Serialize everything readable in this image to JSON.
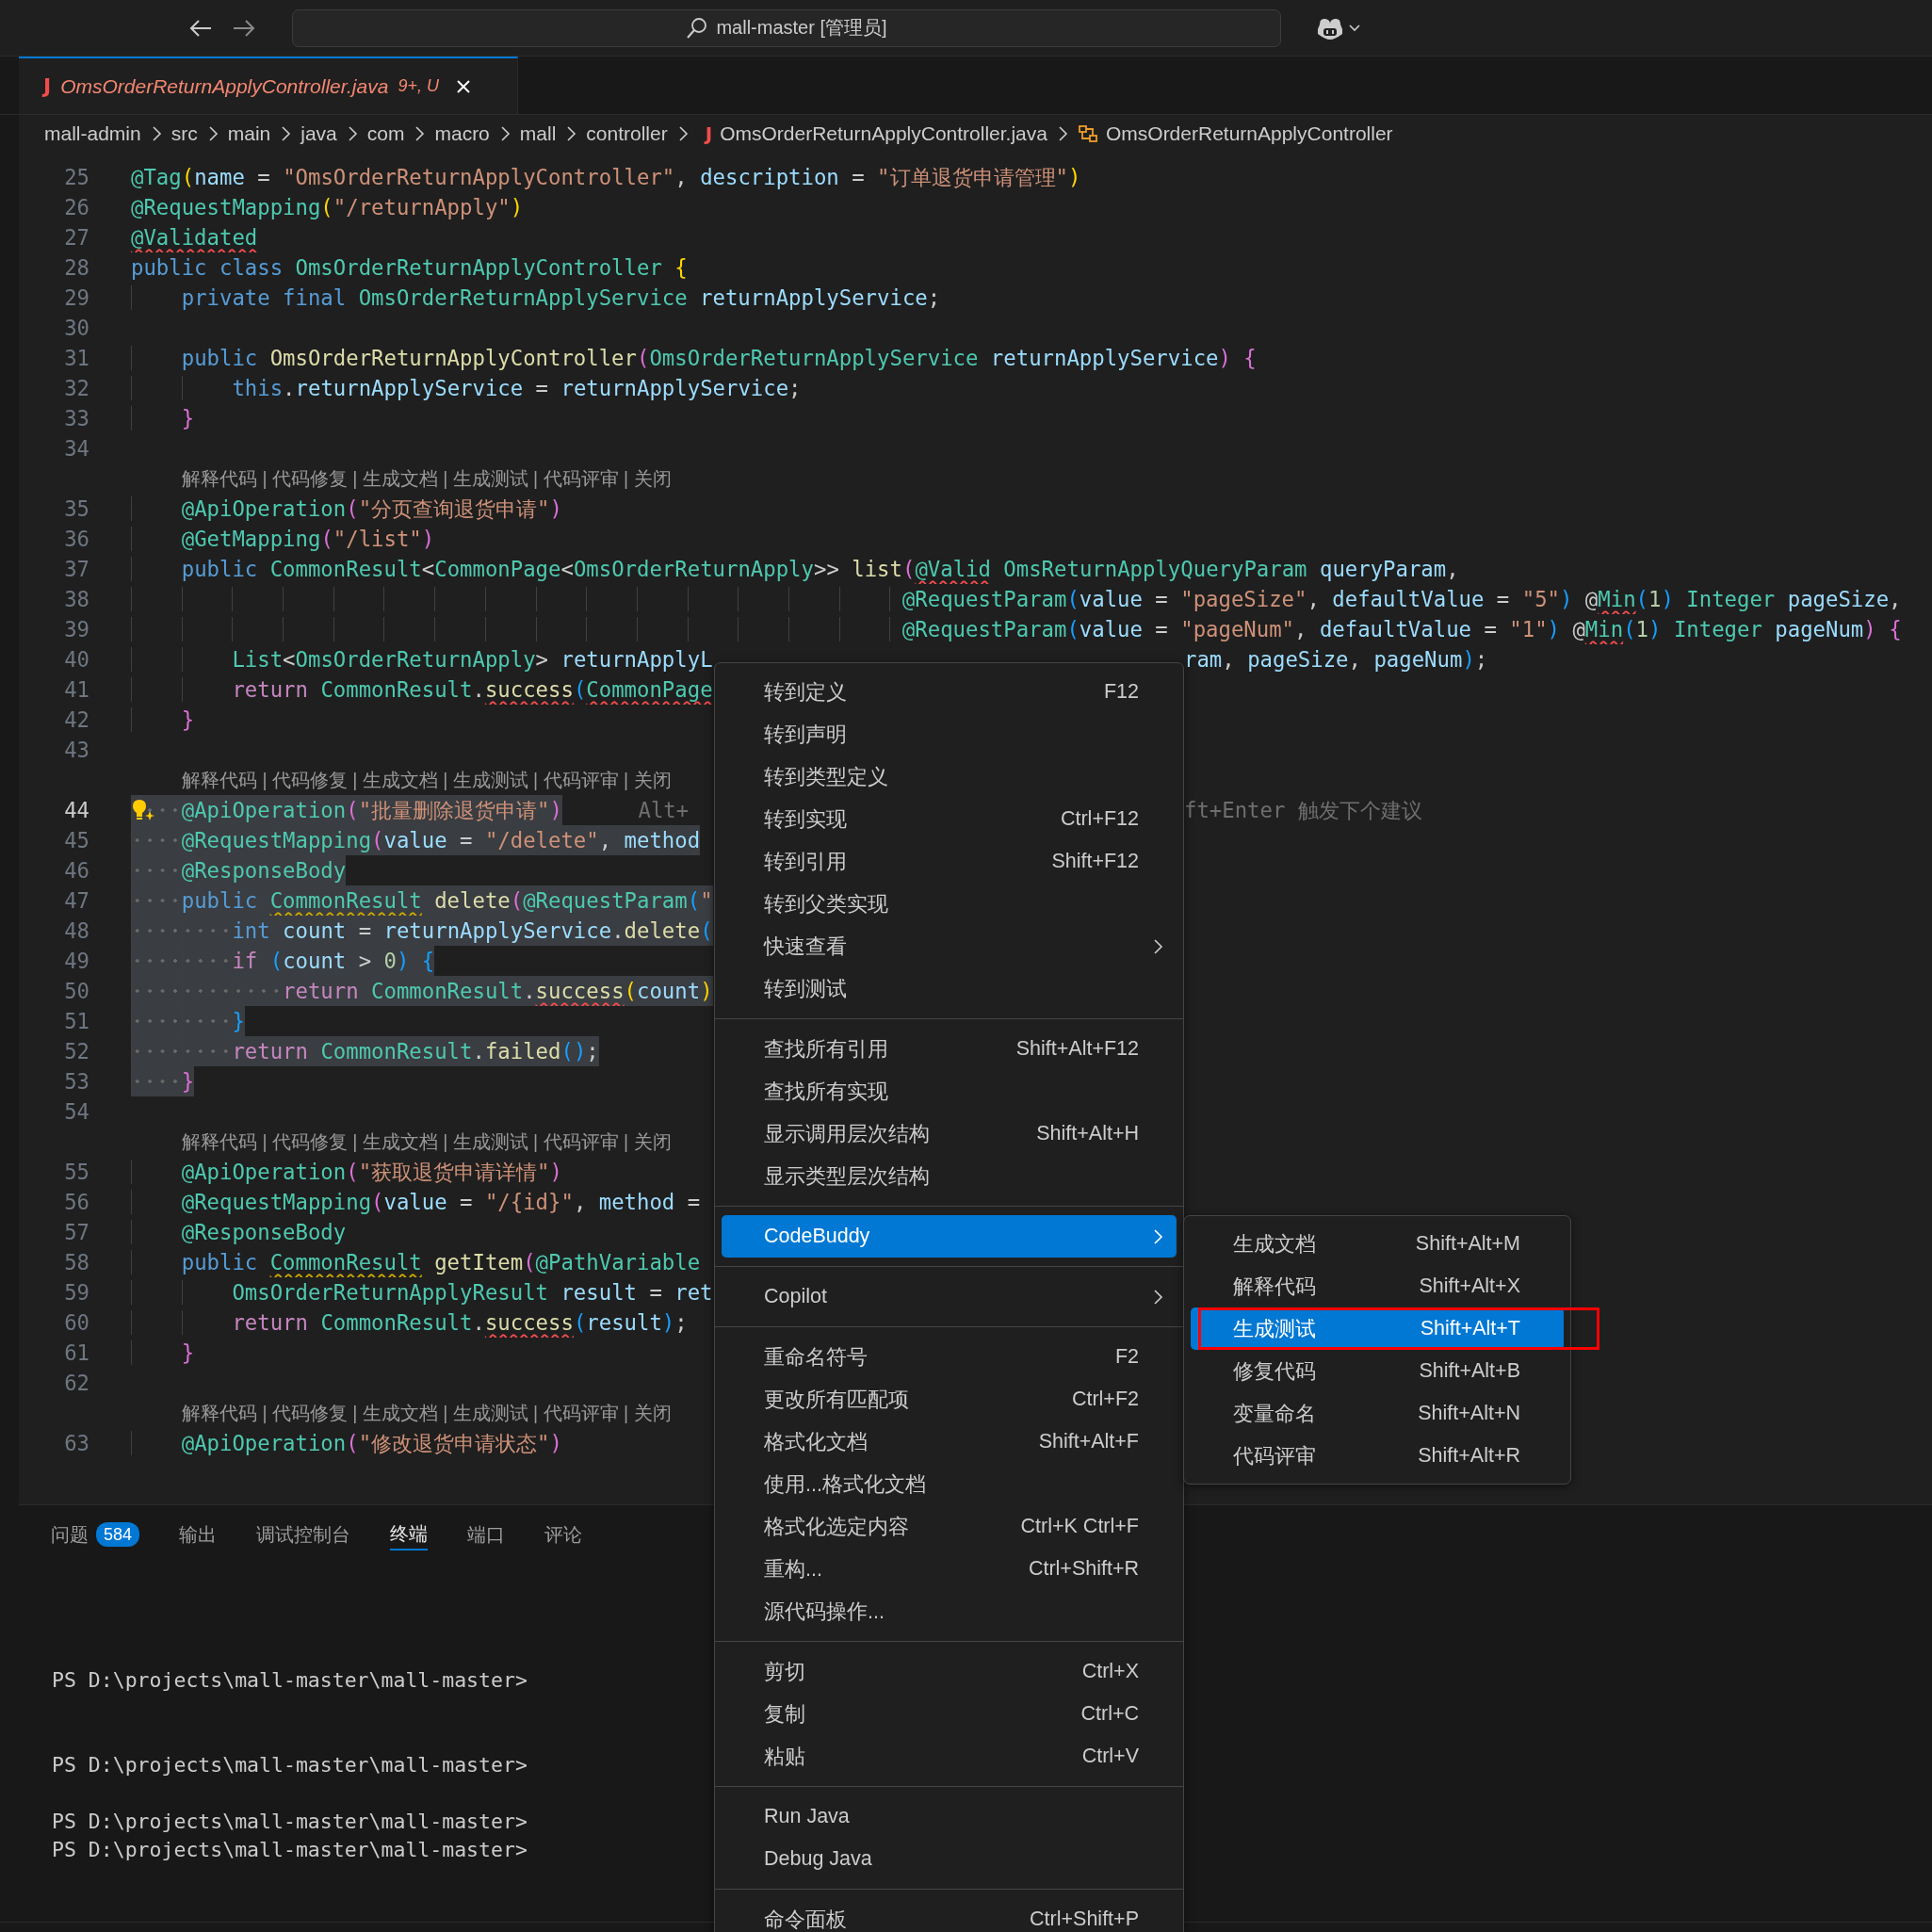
{
  "titlebar": {
    "search_text": "mall-master [管理员]"
  },
  "tabs": [
    {
      "badge": "J",
      "label": "OmsOrderReturnApplyController.java",
      "status": "9+, U",
      "selected": true
    }
  ],
  "breadcrumb": [
    {
      "kind": "folder",
      "text": "mall-admin"
    },
    {
      "kind": "folder",
      "text": "src"
    },
    {
      "kind": "folder",
      "text": "main"
    },
    {
      "kind": "folder",
      "text": "java"
    },
    {
      "kind": "folder",
      "text": "com"
    },
    {
      "kind": "folder",
      "text": "macro"
    },
    {
      "kind": "folder",
      "text": "mall"
    },
    {
      "kind": "folder",
      "text": "controller"
    },
    {
      "kind": "file",
      "badge": "J",
      "text": "OmsOrderReturnApplyController.java"
    },
    {
      "kind": "symbol",
      "text": "OmsOrderReturnApplyController"
    }
  ],
  "editor": {
    "lines": [
      {
        "kind": "code",
        "number": "25",
        "selected": false,
        "current": false,
        "lightbulb": false,
        "tokens": [
          {
            "kind": "ann",
            "text": "@Tag"
          },
          {
            "kind": "b1",
            "text": "("
          },
          {
            "kind": "var",
            "text": "name"
          },
          {
            "kind": "p",
            "text": " = "
          },
          {
            "kind": "str",
            "text": "\"OmsOrderReturnApplyController\""
          },
          {
            "kind": "p",
            "text": ", "
          },
          {
            "kind": "var",
            "text": "description"
          },
          {
            "kind": "p",
            "text": " = "
          },
          {
            "kind": "str",
            "text": "\"订单退货申请管理\""
          },
          {
            "kind": "b1",
            "text": ")"
          }
        ]
      },
      {
        "kind": "code",
        "number": "26",
        "selected": false,
        "current": false,
        "lightbulb": false,
        "tokens": [
          {
            "kind": "ann",
            "text": "@RequestMapping"
          },
          {
            "kind": "b1",
            "text": "("
          },
          {
            "kind": "str",
            "text": "\"/returnApply\""
          },
          {
            "kind": "b1",
            "text": ")"
          }
        ]
      },
      {
        "kind": "code",
        "number": "27",
        "selected": false,
        "current": false,
        "lightbulb": false,
        "tokens": [
          {
            "kind": "ann_error",
            "text": "@Validated"
          }
        ]
      },
      {
        "kind": "code",
        "number": "28",
        "selected": false,
        "current": false,
        "lightbulb": false,
        "tokens": [
          {
            "kind": "kw",
            "text": "public class "
          },
          {
            "kind": "type",
            "text": "OmsOrderReturnApplyController"
          },
          {
            "kind": "b1",
            "text": " {"
          }
        ]
      },
      {
        "kind": "code",
        "number": "29",
        "selected": false,
        "current": false,
        "lightbulb": false,
        "tokens": [
          {
            "kind": "kw",
            "text": "    private final "
          },
          {
            "kind": "type",
            "text": "OmsOrderReturnApplyService"
          },
          {
            "kind": "var",
            "text": " returnApplyService"
          },
          {
            "kind": "p",
            "text": ";"
          }
        ]
      },
      {
        "kind": "code",
        "number": "30",
        "selected": false,
        "current": false,
        "lightbulb": false
      },
      {
        "kind": "code",
        "number": "31",
        "selected": false,
        "current": false,
        "lightbulb": false,
        "tokens": [
          {
            "kind": "kw",
            "text": "    public "
          },
          {
            "kind": "fn",
            "text": "OmsOrderReturnApplyController"
          },
          {
            "kind": "b2",
            "text": "("
          },
          {
            "kind": "type",
            "text": "OmsOrderReturnApplyService"
          },
          {
            "kind": "var",
            "text": " returnApplyService"
          },
          {
            "kind": "b2",
            "text": ")"
          },
          {
            "kind": "b2",
            "text": " {"
          }
        ]
      },
      {
        "kind": "code",
        "number": "32",
        "selected": false,
        "current": false,
        "lightbulb": false,
        "tokens": [
          {
            "kind": "kw",
            "text": "        this"
          },
          {
            "kind": "p",
            "text": "."
          },
          {
            "kind": "var",
            "text": "returnApplyService"
          },
          {
            "kind": "p",
            "text": " = "
          },
          {
            "kind": "var",
            "text": "returnApplyService"
          },
          {
            "kind": "p",
            "text": ";"
          }
        ]
      },
      {
        "kind": "code",
        "number": "33",
        "selected": false,
        "current": false,
        "lightbulb": false,
        "tokens": [
          {
            "kind": "b2",
            "text": "    }"
          }
        ]
      },
      {
        "kind": "code",
        "number": "34",
        "selected": false,
        "current": false,
        "lightbulb": false
      },
      {
        "kind": "lens",
        "text": "解释代码 | 代码修复 | 生成文档 | 生成测试 | 代码评审 | 关闭"
      },
      {
        "kind": "code",
        "number": "35",
        "selected": false,
        "current": false,
        "lightbulb": false,
        "tokens": [
          {
            "kind": "ann",
            "text": "    @ApiOperation"
          },
          {
            "kind": "b2",
            "text": "("
          },
          {
            "kind": "str",
            "text": "\"分页查询退货申请\""
          },
          {
            "kind": "b2",
            "text": ")"
          }
        ]
      },
      {
        "kind": "code",
        "number": "36",
        "selected": false,
        "current": false,
        "lightbulb": false,
        "tokens": [
          {
            "kind": "ann",
            "text": "    @GetMapping"
          },
          {
            "kind": "b2",
            "text": "("
          },
          {
            "kind": "str",
            "text": "\"/list\""
          },
          {
            "kind": "b2",
            "text": ")"
          }
        ]
      },
      {
        "kind": "code",
        "number": "37",
        "selected": false,
        "current": false,
        "lightbulb": false,
        "tokens": [
          {
            "kind": "kw",
            "text": "    public "
          },
          {
            "kind": "type",
            "text": "CommonResult"
          },
          {
            "kind": "p",
            "text": "<"
          },
          {
            "kind": "type",
            "text": "CommonPage"
          },
          {
            "kind": "p",
            "text": "<"
          },
          {
            "kind": "type",
            "text": "OmsOrderReturnApply"
          },
          {
            "kind": "p",
            "text": ">> "
          },
          {
            "kind": "fn",
            "text": "list"
          },
          {
            "kind": "b2",
            "text": "("
          },
          {
            "kind": "ann_error",
            "text": "@Valid"
          },
          {
            "kind": "type",
            "text": " OmsReturnApplyQueryParam"
          },
          {
            "kind": "var",
            "text": " queryParam"
          },
          {
            "kind": "p",
            "text": ","
          }
        ]
      },
      {
        "kind": "code",
        "number": "38",
        "selected": false,
        "current": false,
        "lightbulb": false,
        "tokens": [
          {
            "kind": "ann",
            "text": "                                                             @RequestParam"
          },
          {
            "kind": "b3",
            "text": "("
          },
          {
            "kind": "var",
            "text": "value"
          },
          {
            "kind": "p",
            "text": " = "
          },
          {
            "kind": "str",
            "text": "\"pageSize\""
          },
          {
            "kind": "p",
            "text": ", "
          },
          {
            "kind": "var",
            "text": "defaultValue"
          },
          {
            "kind": "p",
            "text": " = "
          },
          {
            "kind": "str",
            "text": "\"5\""
          },
          {
            "kind": "b3",
            "text": ")"
          },
          {
            "kind": "p",
            "text": " @"
          },
          {
            "kind": "ann_error",
            "text": "Min"
          },
          {
            "kind": "b3",
            "text": "("
          },
          {
            "kind": "num",
            "text": "1"
          },
          {
            "kind": "b3",
            "text": ")"
          },
          {
            "kind": "type",
            "text": " Integer"
          },
          {
            "kind": "var",
            "text": " pageSize"
          },
          {
            "kind": "p",
            "text": ","
          }
        ]
      },
      {
        "kind": "code",
        "number": "39",
        "selected": false,
        "current": false,
        "lightbulb": false,
        "tokens": [
          {
            "kind": "ann",
            "text": "                                                             @RequestParam"
          },
          {
            "kind": "b3",
            "text": "("
          },
          {
            "kind": "var",
            "text": "value"
          },
          {
            "kind": "p",
            "text": " = "
          },
          {
            "kind": "str",
            "text": "\"pageNum\""
          },
          {
            "kind": "p",
            "text": ", "
          },
          {
            "kind": "var",
            "text": "defaultValue"
          },
          {
            "kind": "p",
            "text": " = "
          },
          {
            "kind": "str",
            "text": "\"1\""
          },
          {
            "kind": "b3",
            "text": ")"
          },
          {
            "kind": "p",
            "text": " @"
          },
          {
            "kind": "ann_error",
            "text": "Min"
          },
          {
            "kind": "b3",
            "text": "("
          },
          {
            "kind": "num",
            "text": "1"
          },
          {
            "kind": "b3",
            "text": ")"
          },
          {
            "kind": "type",
            "text": " Integer"
          },
          {
            "kind": "var",
            "text": " pageNum"
          },
          {
            "kind": "b2",
            "text": ")"
          },
          {
            "kind": "b2",
            "text": " {"
          }
        ]
      },
      {
        "kind": "code",
        "number": "40",
        "selected": false,
        "current": false,
        "lightbulb": false,
        "tokens": [
          {
            "kind": "type",
            "text": "        List"
          },
          {
            "kind": "p",
            "text": "<"
          },
          {
            "kind": "type",
            "text": "OmsOrderReturnApply"
          },
          {
            "kind": "p",
            "text": "> "
          },
          {
            "kind": "var",
            "text": "returnApplyL"
          }
        ],
        "after_menu": [
          {
            "kind": "var",
            "text": "ram"
          },
          {
            "kind": "p",
            "text": ", "
          },
          {
            "kind": "var",
            "text": "pageSize"
          },
          {
            "kind": "p",
            "text": ", "
          },
          {
            "kind": "var",
            "text": "pageNum"
          },
          {
            "kind": "b3",
            "text": ")"
          },
          {
            "kind": "p",
            "text": ";"
          }
        ]
      },
      {
        "kind": "code",
        "number": "41",
        "selected": false,
        "current": false,
        "lightbulb": false,
        "tokens": [
          {
            "kind": "ctl",
            "text": "        return "
          },
          {
            "kind": "type",
            "text": "CommonResult"
          },
          {
            "kind": "p",
            "text": "."
          },
          {
            "kind": "fn_error",
            "text": "success"
          },
          {
            "kind": "b3",
            "text": "("
          },
          {
            "kind": "type_error",
            "text": "CommonPage"
          }
        ]
      },
      {
        "kind": "code",
        "number": "42",
        "selected": false,
        "current": false,
        "lightbulb": false,
        "tokens": [
          {
            "kind": "b2",
            "text": "    }"
          }
        ]
      },
      {
        "kind": "code",
        "number": "43",
        "selected": false,
        "current": false,
        "lightbulb": false
      },
      {
        "kind": "lens",
        "text": "解释代码 | 代码修复 | 生成文档 | 生成测试 | 代码评审 | 关闭"
      },
      {
        "kind": "code",
        "number": "44",
        "selected": true,
        "current": true,
        "lightbulb": true,
        "tokens": [
          {
            "kind": "ann",
            "text": "    @ApiOperation"
          },
          {
            "kind": "b2",
            "text": "("
          },
          {
            "kind": "str",
            "text": "\"批量删除退货申请\""
          },
          {
            "kind": "b2",
            "text": ")"
          },
          {
            "kind": "ghost",
            "text": "Alt+"
          }
        ],
        "after_menu": [
          {
            "kind": "ghost",
            "text": "ft+Enter 触发下个建议"
          }
        ]
      },
      {
        "kind": "code",
        "number": "45",
        "selected": true,
        "current": false,
        "lightbulb": false,
        "tokens": [
          {
            "kind": "ann",
            "text": "    @RequestMapping"
          },
          {
            "kind": "b2",
            "text": "("
          },
          {
            "kind": "var",
            "text": "value"
          },
          {
            "kind": "p",
            "text": " = "
          },
          {
            "kind": "str",
            "text": "\"/delete\""
          },
          {
            "kind": "p",
            "text": ", "
          },
          {
            "kind": "var",
            "text": "method"
          }
        ]
      },
      {
        "kind": "code",
        "number": "46",
        "selected": true,
        "current": false,
        "lightbulb": false,
        "tokens": [
          {
            "kind": "ann",
            "text": "    @ResponseBody"
          }
        ]
      },
      {
        "kind": "code",
        "number": "47",
        "selected": true,
        "current": false,
        "lightbulb": false,
        "tokens": [
          {
            "kind": "kw",
            "text": "    public "
          },
          {
            "kind": "type_warning",
            "text": "CommonResult"
          },
          {
            "kind": "fn",
            "text": " delete"
          },
          {
            "kind": "b2",
            "text": "("
          },
          {
            "kind": "ann",
            "text": "@RequestParam"
          },
          {
            "kind": "b3",
            "text": "("
          },
          {
            "kind": "str",
            "text": "\""
          }
        ]
      },
      {
        "kind": "code",
        "number": "48",
        "selected": true,
        "current": false,
        "lightbulb": false,
        "tokens": [
          {
            "kind": "kw",
            "text": "        int "
          },
          {
            "kind": "var",
            "text": "count"
          },
          {
            "kind": "p",
            "text": " = "
          },
          {
            "kind": "var",
            "text": "returnApplyService"
          },
          {
            "kind": "p",
            "text": "."
          },
          {
            "kind": "fn",
            "text": "delete"
          },
          {
            "kind": "b3",
            "text": "("
          }
        ]
      },
      {
        "kind": "code",
        "number": "49",
        "selected": true,
        "current": false,
        "lightbulb": false,
        "tokens": [
          {
            "kind": "ctl",
            "text": "        if "
          },
          {
            "kind": "b3",
            "text": "("
          },
          {
            "kind": "var",
            "text": "count"
          },
          {
            "kind": "p",
            "text": " > "
          },
          {
            "kind": "num",
            "text": "0"
          },
          {
            "kind": "b3",
            "text": ")"
          },
          {
            "kind": "b3",
            "text": " {"
          }
        ]
      },
      {
        "kind": "code",
        "number": "50",
        "selected": true,
        "current": false,
        "lightbulb": false,
        "tokens": [
          {
            "kind": "ctl",
            "text": "            return "
          },
          {
            "kind": "type",
            "text": "CommonResult"
          },
          {
            "kind": "p",
            "text": "."
          },
          {
            "kind": "fn_error",
            "text": "success"
          },
          {
            "kind": "b1",
            "text": "("
          },
          {
            "kind": "var",
            "text": "count"
          },
          {
            "kind": "b1",
            "text": ")"
          }
        ]
      },
      {
        "kind": "code",
        "number": "51",
        "selected": true,
        "current": false,
        "lightbulb": false,
        "tokens": [
          {
            "kind": "b3",
            "text": "        }"
          }
        ]
      },
      {
        "kind": "code",
        "number": "52",
        "selected": true,
        "current": false,
        "lightbulb": false,
        "tokens": [
          {
            "kind": "ctl",
            "text": "        return "
          },
          {
            "kind": "type",
            "text": "CommonResult"
          },
          {
            "kind": "p",
            "text": "."
          },
          {
            "kind": "fn",
            "text": "failed"
          },
          {
            "kind": "b3",
            "text": "()"
          },
          {
            "kind": "p",
            "text": ";"
          }
        ]
      },
      {
        "kind": "code",
        "number": "53",
        "selected": true,
        "current": false,
        "lightbulb": false,
        "tokens": [
          {
            "kind": "b2",
            "text": "    }"
          }
        ]
      },
      {
        "kind": "code",
        "number": "54",
        "selected": false,
        "current": false,
        "lightbulb": false
      },
      {
        "kind": "lens",
        "text": "解释代码 | 代码修复 | 生成文档 | 生成测试 | 代码评审 | 关闭"
      },
      {
        "kind": "code",
        "number": "55",
        "selected": false,
        "current": false,
        "lightbulb": false,
        "tokens": [
          {
            "kind": "ann",
            "text": "    @ApiOperation"
          },
          {
            "kind": "b2",
            "text": "("
          },
          {
            "kind": "str",
            "text": "\"获取退货申请详情\""
          },
          {
            "kind": "b2",
            "text": ")"
          }
        ]
      },
      {
        "kind": "code",
        "number": "56",
        "selected": false,
        "current": false,
        "lightbulb": false,
        "tokens": [
          {
            "kind": "ann",
            "text": "    @RequestMapping"
          },
          {
            "kind": "b2",
            "text": "("
          },
          {
            "kind": "var",
            "text": "value"
          },
          {
            "kind": "p",
            "text": " = "
          },
          {
            "kind": "str",
            "text": "\"/{id}\""
          },
          {
            "kind": "p",
            "text": ", "
          },
          {
            "kind": "var",
            "text": "method"
          },
          {
            "kind": "p",
            "text": " ="
          }
        ]
      },
      {
        "kind": "code",
        "number": "57",
        "selected": false,
        "current": false,
        "lightbulb": false,
        "tokens": [
          {
            "kind": "ann",
            "text": "    @ResponseBody"
          }
        ]
      },
      {
        "kind": "code",
        "number": "58",
        "selected": false,
        "current": false,
        "lightbulb": false,
        "tokens": [
          {
            "kind": "kw",
            "text": "    public "
          },
          {
            "kind": "type_warning",
            "text": "CommonResult"
          },
          {
            "kind": "fn",
            "text": " getItem"
          },
          {
            "kind": "b2",
            "text": "("
          },
          {
            "kind": "ann",
            "text": "@PathVariable"
          }
        ]
      },
      {
        "kind": "code",
        "number": "59",
        "selected": false,
        "current": false,
        "lightbulb": false,
        "tokens": [
          {
            "kind": "type",
            "text": "        OmsOrderReturnApplyResult"
          },
          {
            "kind": "var",
            "text": " result"
          },
          {
            "kind": "p",
            "text": " = "
          },
          {
            "kind": "var",
            "text": "ret"
          }
        ]
      },
      {
        "kind": "code",
        "number": "60",
        "selected": false,
        "current": false,
        "lightbulb": false,
        "tokens": [
          {
            "kind": "ctl",
            "text": "        return "
          },
          {
            "kind": "type",
            "text": "CommonResult"
          },
          {
            "kind": "p",
            "text": "."
          },
          {
            "kind": "fn_error",
            "text": "success"
          },
          {
            "kind": "b3",
            "text": "("
          },
          {
            "kind": "var",
            "text": "result"
          },
          {
            "kind": "b3",
            "text": ")"
          },
          {
            "kind": "p",
            "text": ";"
          }
        ]
      },
      {
        "kind": "code",
        "number": "61",
        "selected": false,
        "current": false,
        "lightbulb": false,
        "tokens": [
          {
            "kind": "b2",
            "text": "    }"
          }
        ]
      },
      {
        "kind": "code",
        "number": "62",
        "selected": false,
        "current": false,
        "lightbulb": false
      },
      {
        "kind": "lens",
        "text": "解释代码 | 代码修复 | 生成文档 | 生成测试 | 代码评审 | 关闭"
      },
      {
        "kind": "code",
        "number": "63",
        "selected": false,
        "current": false,
        "lightbulb": false,
        "tokens": [
          {
            "kind": "ann",
            "text": "    @ApiOperation"
          },
          {
            "kind": "b2",
            "text": "("
          },
          {
            "kind": "str",
            "text": "\"修改退货申请状态\""
          },
          {
            "kind": "b2",
            "text": ")"
          }
        ]
      }
    ]
  },
  "panel": {
    "tabs": [
      {
        "label": "问题",
        "badge": "584",
        "selected": false
      },
      {
        "label": "输出",
        "selected": false
      },
      {
        "label": "调试控制台",
        "selected": false
      },
      {
        "label": "终端",
        "selected": true
      },
      {
        "label": "端口",
        "selected": false
      },
      {
        "label": "评论",
        "selected": false
      }
    ],
    "terminal_lines": [
      "PS D:\\projects\\mall-master\\mall-master>",
      "PS D:\\projects\\mall-master\\mall-master>",
      "PS D:\\projects\\mall-master\\mall-master>",
      "PS D:\\projects\\mall-master\\mall-master>"
    ]
  },
  "context_menu": {
    "items": [
      {
        "kind": "item",
        "label": "转到定义",
        "shortcut": "F12",
        "submenu": false,
        "selected": false
      },
      {
        "kind": "item",
        "label": "转到声明",
        "submenu": false,
        "selected": false
      },
      {
        "kind": "item",
        "label": "转到类型定义",
        "submenu": false,
        "selected": false
      },
      {
        "kind": "item",
        "label": "转到实现",
        "shortcut": "Ctrl+F12",
        "submenu": false,
        "selected": false
      },
      {
        "kind": "item",
        "label": "转到引用",
        "shortcut": "Shift+F12",
        "submenu": false,
        "selected": false
      },
      {
        "kind": "item",
        "label": "转到父类实现",
        "submenu": false,
        "selected": false
      },
      {
        "kind": "item",
        "label": "快速查看",
        "submenu": true,
        "selected": false
      },
      {
        "kind": "item",
        "label": "转到测试",
        "submenu": false,
        "selected": false
      },
      {
        "kind": "separator"
      },
      {
        "kind": "item",
        "label": "查找所有引用",
        "shortcut": "Shift+Alt+F12",
        "submenu": false,
        "selected": false
      },
      {
        "kind": "item",
        "label": "查找所有实现",
        "submenu": false,
        "selected": false
      },
      {
        "kind": "item",
        "label": "显示调用层次结构",
        "shortcut": "Shift+Alt+H",
        "submenu": false,
        "selected": false
      },
      {
        "kind": "item",
        "label": "显示类型层次结构",
        "submenu": false,
        "selected": false
      },
      {
        "kind": "separator"
      },
      {
        "kind": "item",
        "label": "CodeBuddy",
        "submenu": true,
        "selected": true
      },
      {
        "kind": "separator"
      },
      {
        "kind": "item",
        "label": "Copilot",
        "submenu": true,
        "selected": false
      },
      {
        "kind": "separator"
      },
      {
        "kind": "item",
        "label": "重命名符号",
        "shortcut": "F2",
        "submenu": false,
        "selected": false
      },
      {
        "kind": "item",
        "label": "更改所有匹配项",
        "shortcut": "Ctrl+F2",
        "submenu": false,
        "selected": false
      },
      {
        "kind": "item",
        "label": "格式化文档",
        "shortcut": "Shift+Alt+F",
        "submenu": false,
        "selected": false
      },
      {
        "kind": "item",
        "label": "使用...格式化文档",
        "submenu": false,
        "selected": false
      },
      {
        "kind": "item",
        "label": "格式化选定内容",
        "shortcut": "Ctrl+K Ctrl+F",
        "submenu": false,
        "selected": false
      },
      {
        "kind": "item",
        "label": "重构...",
        "shortcut": "Ctrl+Shift+R",
        "submenu": false,
        "selected": false
      },
      {
        "kind": "item",
        "label": "源代码操作...",
        "submenu": false,
        "selected": false
      },
      {
        "kind": "separator"
      },
      {
        "kind": "item",
        "label": "剪切",
        "shortcut": "Ctrl+X",
        "submenu": false,
        "selected": false
      },
      {
        "kind": "item",
        "label": "复制",
        "shortcut": "Ctrl+C",
        "submenu": false,
        "selected": false
      },
      {
        "kind": "item",
        "label": "粘贴",
        "shortcut": "Ctrl+V",
        "submenu": false,
        "selected": false
      },
      {
        "kind": "separator"
      },
      {
        "kind": "item",
        "label": "Run Java",
        "submenu": false,
        "selected": false
      },
      {
        "kind": "item",
        "label": "Debug Java",
        "submenu": false,
        "selected": false
      },
      {
        "kind": "separator"
      },
      {
        "kind": "item",
        "label": "命令面板",
        "shortcut": "Ctrl+Shift+P",
        "submenu": false,
        "selected": false
      }
    ]
  },
  "submenu": {
    "items": [
      {
        "label": "生成文档",
        "shortcut": "Shift+Alt+M",
        "selected": false,
        "annotated": false
      },
      {
        "label": "解释代码",
        "shortcut": "Shift+Alt+X",
        "selected": false,
        "annotated": false
      },
      {
        "label": "生成测试",
        "shortcut": "Shift+Alt+T",
        "selected": true,
        "annotated": true
      },
      {
        "label": "修复代码",
        "shortcut": "Shift+Alt+B",
        "selected": false,
        "annotated": false
      },
      {
        "label": "变量命名",
        "shortcut": "Shift+Alt+N",
        "selected": false,
        "annotated": false
      },
      {
        "label": "代码评审",
        "shortcut": "Shift+Alt+R",
        "selected": false,
        "annotated": false
      }
    ]
  }
}
